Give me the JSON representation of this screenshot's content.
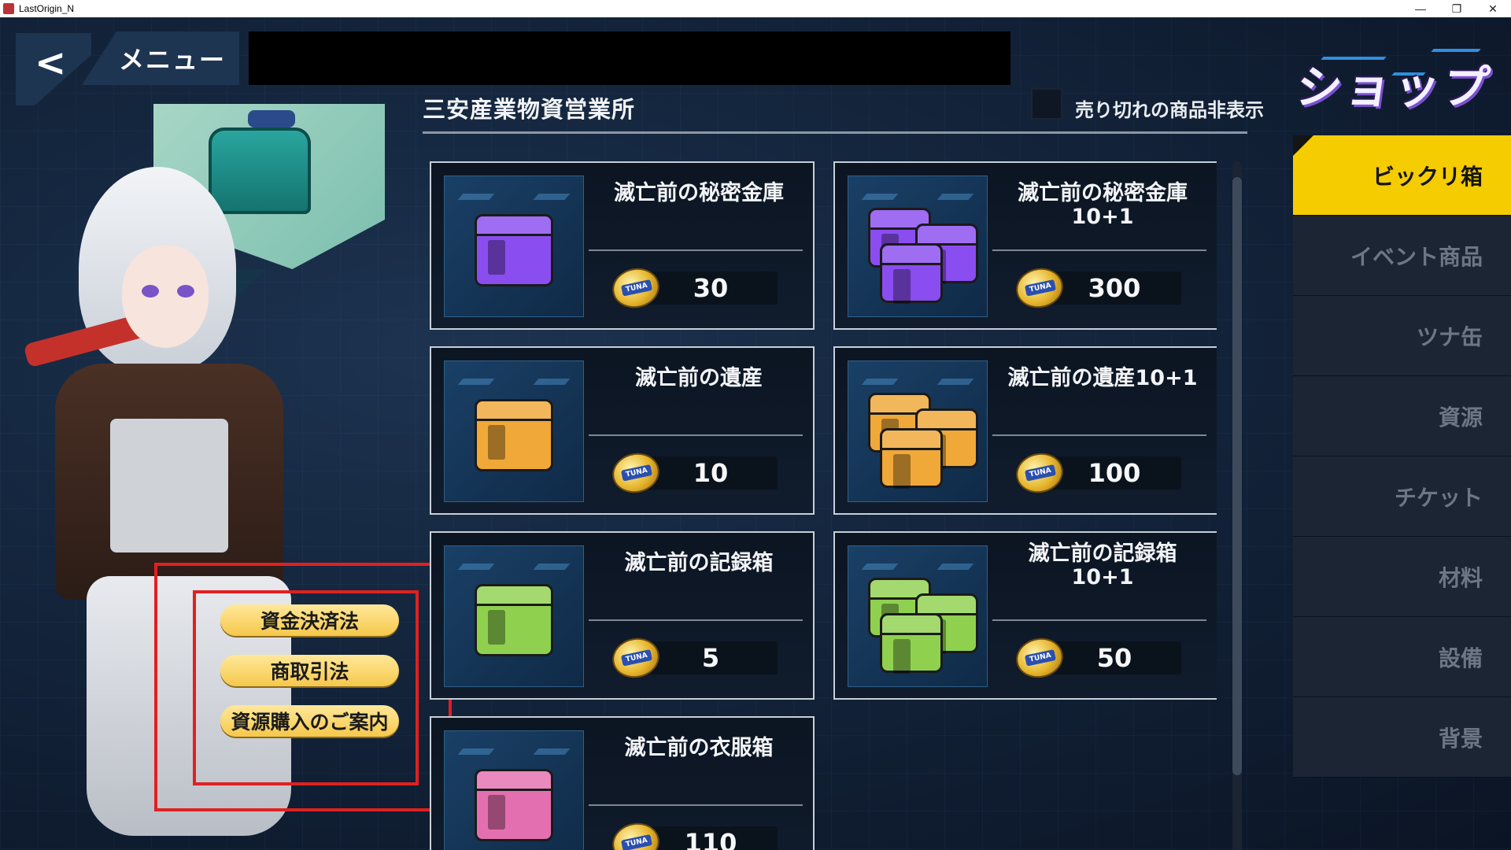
{
  "window": {
    "title": "LastOrigin_N",
    "controls": [
      "—",
      "❐",
      "✕"
    ]
  },
  "nav": {
    "back_icon": "chevron-left-icon",
    "menu_label": "メニュー"
  },
  "shop": {
    "store_name": "三安産業物資営業所",
    "hide_soldout_label": "売り切れの商品非表示",
    "logo_text": "ショップ"
  },
  "info_buttons": [
    {
      "label": "資金決済法"
    },
    {
      "label": "商取引法"
    },
    {
      "label": "資源購入のご案内"
    }
  ],
  "products": [
    {
      "name": "滅亡前の秘密金庫",
      "price": "30",
      "color": "#8a4df0"
    },
    {
      "name": "滅亡前の秘密金庫10+1",
      "price": "300",
      "color": "#8a4df0"
    },
    {
      "name": "滅亡前の遺産",
      "price": "10",
      "color": "#f0a838"
    },
    {
      "name": "滅亡前の遺産10+1",
      "price": "100",
      "color": "#f0a838"
    },
    {
      "name": "滅亡前の記録箱",
      "price": "5",
      "color": "#8fd14f"
    },
    {
      "name": "滅亡前の記録箱\n10+1",
      "price": "50",
      "color": "#8fd14f"
    },
    {
      "name": "滅亡前の衣服箱",
      "price": "110",
      "color": "#e46fb0"
    }
  ],
  "coin": {
    "label": "TUNA"
  },
  "categories": [
    {
      "label": "ビックリ箱",
      "active": true
    },
    {
      "label": "イベント商品",
      "active": false
    },
    {
      "label": "ツナ缶",
      "active": false
    },
    {
      "label": "資源",
      "active": false
    },
    {
      "label": "チケット",
      "active": false
    },
    {
      "label": "材料",
      "active": false
    },
    {
      "label": "設備",
      "active": false
    },
    {
      "label": "背景",
      "active": false
    }
  ]
}
